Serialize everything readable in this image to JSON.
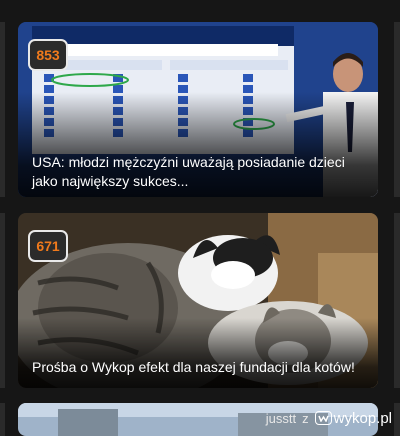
{
  "posts": [
    {
      "votes": "853",
      "title": "USA: młodzi mężczyźni uważają posiadanie dzieci jako największy sukces...",
      "image": "decision-desk-poll-tv-broadcast"
    },
    {
      "votes": "671",
      "title": "Prośba o Wykop efekt dla naszej fundacji dla kotów!",
      "image": "two-cats-cuddling"
    }
  ],
  "footer": {
    "author": "jusstt",
    "separator": "z",
    "brand": "wykop.pl"
  },
  "colors": {
    "vote_count": "#f07a1c",
    "background": "#161616"
  }
}
